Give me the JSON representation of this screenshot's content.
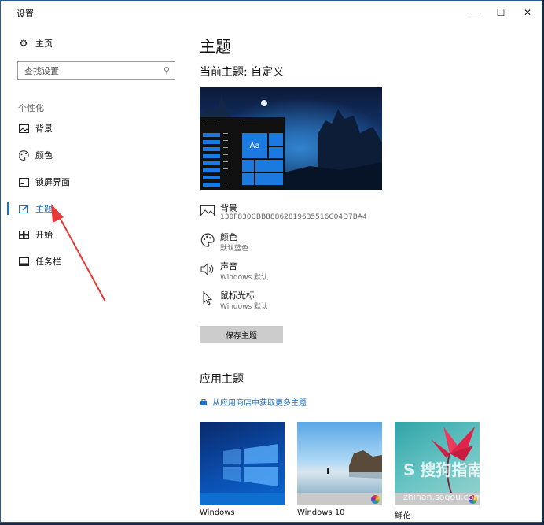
{
  "window": {
    "title": "设置",
    "minimize_glyph": "—",
    "maximize_glyph": "☐",
    "close_glyph": "✕"
  },
  "sidebar": {
    "home_label": "主页",
    "search_placeholder": "查找设置",
    "section_label": "个性化",
    "items": [
      {
        "label": "背景",
        "icon": "image-icon"
      },
      {
        "label": "颜色",
        "icon": "palette-icon"
      },
      {
        "label": "锁屏界面",
        "icon": "lockscreen-icon"
      },
      {
        "label": "主题",
        "icon": "theme-icon",
        "active": true
      },
      {
        "label": "开始",
        "icon": "start-icon"
      },
      {
        "label": "任务栏",
        "icon": "taskbar-icon"
      }
    ]
  },
  "main": {
    "page_title": "主题",
    "current_theme_label": "当前主题: 自定义",
    "preview_tile_text": "Aa",
    "properties": [
      {
        "name": "背景",
        "value": "130F830CBB88862819635516C04D7BA4",
        "icon": "image-icon"
      },
      {
        "name": "颜色",
        "value": "默认蓝色",
        "icon": "palette-icon"
      },
      {
        "name": "声音",
        "value": "Windows 默认",
        "icon": "speaker-icon"
      },
      {
        "name": "鼠标光标",
        "value": "Windows 默认",
        "icon": "cursor-icon"
      }
    ],
    "save_button": "保存主题",
    "apply_title": "应用主题",
    "store_link": "从应用商店中获取更多主题",
    "themes": [
      {
        "name": "Windows"
      },
      {
        "name": "Windows 10"
      },
      {
        "name": "鲜花"
      }
    ]
  },
  "watermark": {
    "brand": "S 搜狗指南",
    "url": "zhinan.sogou.com"
  },
  "colors": {
    "accent": "#1b6fc4",
    "tile_blue": "#0f6fd1"
  }
}
